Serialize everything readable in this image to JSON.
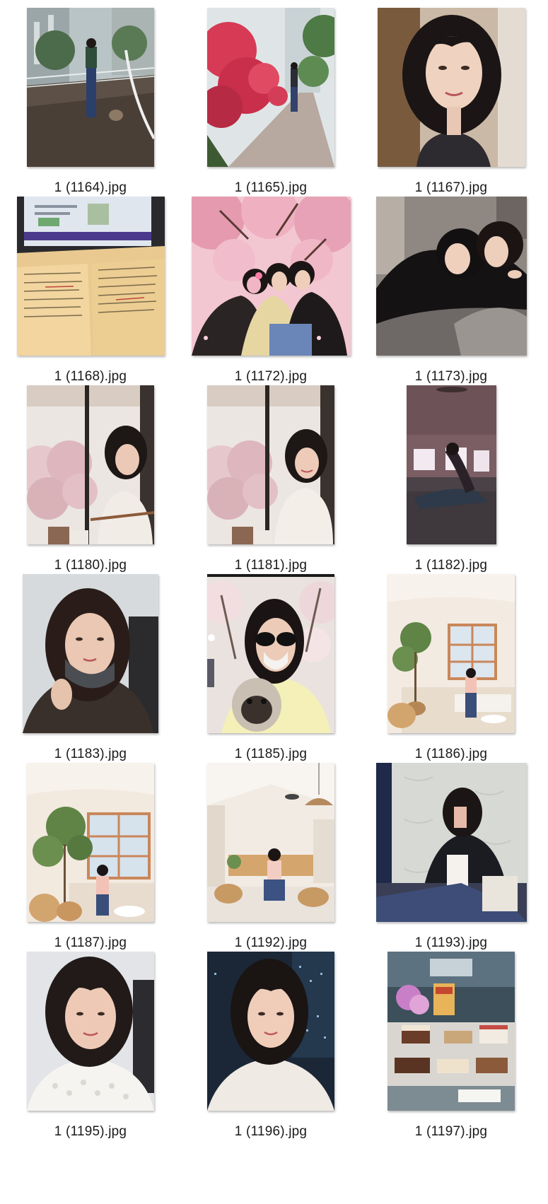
{
  "files": [
    {
      "name": "1 (1164).jpg",
      "image": "walking-dog-on-bridge-photo"
    },
    {
      "name": "1 (1165).jpg",
      "image": "azalea-path-walk-photo"
    },
    {
      "name": "1 (1167).jpg",
      "image": "selfie-portrait-photo"
    },
    {
      "name": "1 (1168).jpg",
      "image": "study-notes-laptop-photo"
    },
    {
      "name": "1 (1172).jpg",
      "image": "cherry-blossom-friends-photo"
    },
    {
      "name": "1 (1173).jpg",
      "image": "two-women-lying-photo"
    },
    {
      "name": "1 (1180).jpg",
      "image": "cafe-window-blossoms-photo"
    },
    {
      "name": "1 (1181).jpg",
      "image": "cafe-window-smile-photo"
    },
    {
      "name": "1 (1182).jpg",
      "image": "yoga-stretch-photo"
    },
    {
      "name": "1 (1183).jpg",
      "image": "office-selfie-mask-photo"
    },
    {
      "name": "1 (1185).jpg",
      "image": "sunglasses-pug-photo"
    },
    {
      "name": "1 (1186).jpg",
      "image": "bright-cafe-seated-photo"
    },
    {
      "name": "1 (1187).jpg",
      "image": "bright-cafe-plant-photo"
    },
    {
      "name": "1 (1192).jpg",
      "image": "cafe-hall-seated-photo"
    },
    {
      "name": "1 (1193).jpg",
      "image": "mirror-selfie-photo"
    },
    {
      "name": "1 (1195).jpg",
      "image": "white-lace-selfie-photo"
    },
    {
      "name": "1 (1196).jpg",
      "image": "night-city-selfie-photo"
    },
    {
      "name": "1 (1197).jpg",
      "image": "bakery-display-photo"
    }
  ],
  "colors": {
    "background": "#ffffff",
    "label_text": "#1a1a1a"
  }
}
